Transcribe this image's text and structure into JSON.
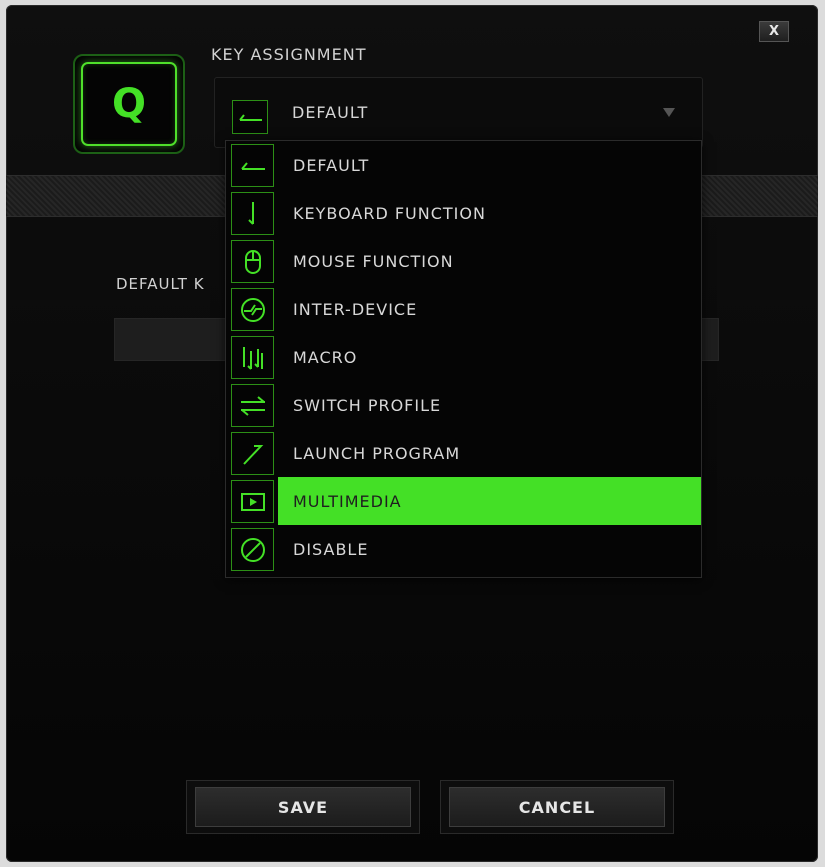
{
  "dialog": {
    "close_label": "X",
    "key_label": "Q",
    "key_assignment_label": "KEY ASSIGNMENT",
    "selected_value": "DEFAULT",
    "default_key_label": "DEFAULT K"
  },
  "dropdown": {
    "items": [
      {
        "label": "DEFAULT",
        "icon": "default-arrow-icon"
      },
      {
        "label": "KEYBOARD FUNCTION",
        "icon": "keyboard-function-icon"
      },
      {
        "label": "MOUSE FUNCTION",
        "icon": "mouse-icon"
      },
      {
        "label": "INTER-DEVICE",
        "icon": "inter-device-icon"
      },
      {
        "label": "MACRO",
        "icon": "macro-icon"
      },
      {
        "label": "SWITCH PROFILE",
        "icon": "switch-profile-icon"
      },
      {
        "label": "LAUNCH PROGRAM",
        "icon": "launch-program-icon"
      },
      {
        "label": "MULTIMEDIA",
        "icon": "multimedia-icon"
      },
      {
        "label": "DISABLE",
        "icon": "disable-icon"
      }
    ],
    "highlighted_item": "MULTIMEDIA"
  },
  "buttons": {
    "save": "SAVE",
    "cancel": "CANCEL"
  },
  "colors": {
    "accent_green": "#44e026",
    "icon_border": "#2c8f16",
    "background": "#0a0a0a"
  }
}
